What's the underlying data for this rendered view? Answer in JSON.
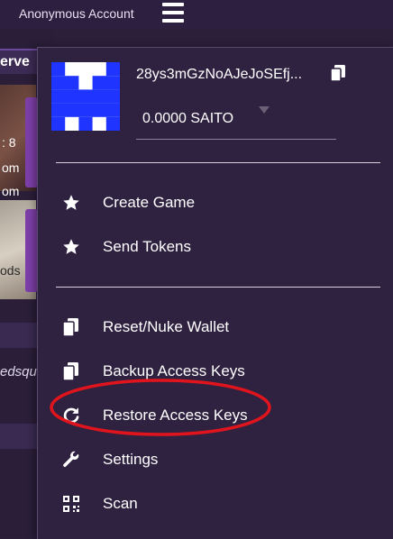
{
  "header": {
    "account_name": "Anonymous Account"
  },
  "background": {
    "bar_text": "erve",
    "card1_lines": [
      ": 8",
      "om",
      "om"
    ],
    "card2_text": "ods",
    "italic_text": "edsqu"
  },
  "wallet": {
    "address": "28ys3mGzNoAJeJoSEfj...",
    "balance": "0.0000 SAITO"
  },
  "menu": {
    "create_game": "Create Game",
    "send_tokens": "Send Tokens",
    "reset_wallet": "Reset/Nuke Wallet",
    "backup_keys": "Backup Access Keys",
    "restore_keys": "Restore Access Keys",
    "settings": "Settings",
    "scan": "Scan"
  },
  "colors": {
    "menu_bg": "#2f2240",
    "identicon_blue": "#1f35ff",
    "highlight_ring": "#e0141c"
  }
}
